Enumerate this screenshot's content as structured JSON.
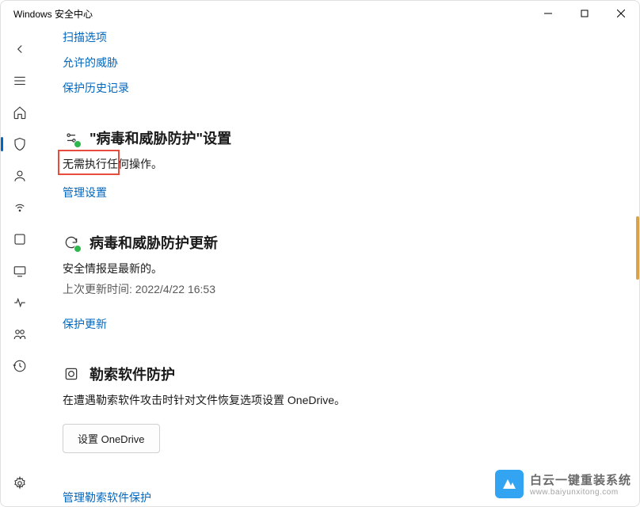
{
  "window": {
    "title": "Windows 安全中心"
  },
  "topLinks": {
    "scanOptions": "扫描选项",
    "allowedThreats": "允许的威胁",
    "protectionHistory": "保护历史记录"
  },
  "settings": {
    "title": "\"病毒和威胁防护\"设置",
    "desc": "无需执行任何操作。",
    "manage": "管理设置"
  },
  "updates": {
    "title": "病毒和威胁防护更新",
    "desc": "安全情报是最新的。",
    "lastUpdate": "上次更新时间: 2022/4/22 16:53",
    "link": "保护更新"
  },
  "ransomware": {
    "title": "勒索软件防护",
    "desc": "在遭遇勒索软件攻击时针对文件恢复选项设置 OneDrive。",
    "button": "设置 OneDrive",
    "manage": "管理勒索软件保护"
  },
  "watermark": {
    "title": "白云一键重装系统",
    "url": "www.baiyunxitong.com"
  }
}
